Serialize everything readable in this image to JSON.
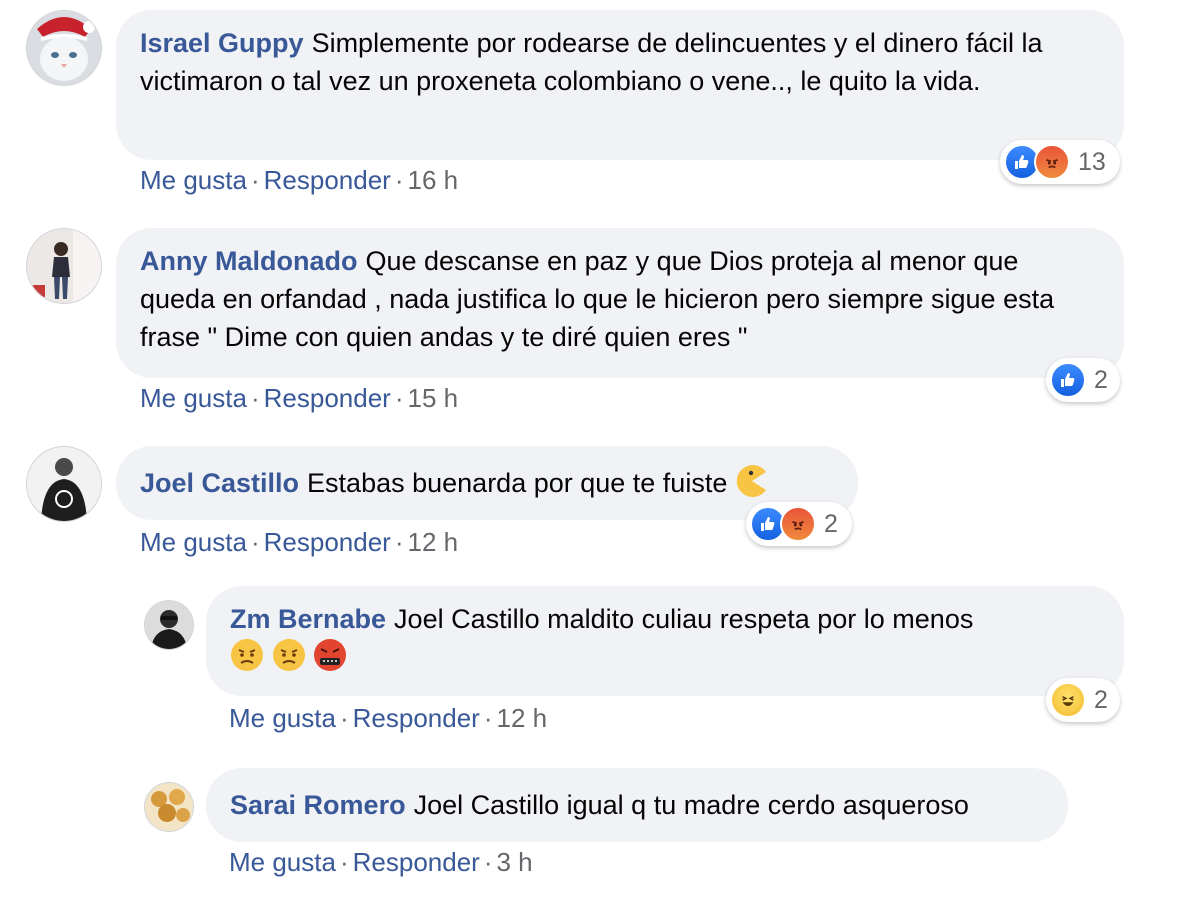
{
  "comments": [
    {
      "author": "Israel Guppy",
      "text": "Simplemente por rodearse de delincuentes y el dinero fácil la victimaron o tal vez un proxeneta colombiano o vene.., le quito la vida.",
      "like_label": "Me gusta",
      "reply_label": "Responder",
      "time": "16 h",
      "reaction_count": "13",
      "reactions": [
        "like-icon",
        "angry-icon"
      ]
    },
    {
      "author": "Anny Maldonado",
      "text": "Que descanse en paz y que Dios proteja al menor que queda en orfandad , nada justifica lo que le hicieron pero siempre sigue esta frase \" Dime con quien andas y te diré quien eres \"",
      "like_label": "Me gusta",
      "reply_label": "Responder",
      "time": "15 h",
      "reaction_count": "2",
      "reactions": [
        "like-icon"
      ]
    },
    {
      "author": "Joel Castillo",
      "text": "Estabas buenarda por que te fuiste",
      "emoji": "pacman-emoji-icon",
      "like_label": "Me gusta",
      "reply_label": "Responder",
      "time": "12 h",
      "reaction_count": "2",
      "reactions": [
        "like-icon",
        "angry-icon"
      ]
    }
  ],
  "replies": [
    {
      "author": "Zm Bernabe",
      "text": "Joel Castillo maldito culiau respeta por lo menos",
      "emojis": [
        "angry-face-icon",
        "angry-face-icon",
        "cursing-face-icon"
      ],
      "like_label": "Me gusta",
      "reply_label": "Responder",
      "time": "12 h",
      "reaction_count": "2",
      "reactions": [
        "haha-icon"
      ]
    },
    {
      "author": "Sarai Romero",
      "text": "Joel Castillo igual q tu madre cerdo asqueroso",
      "like_label": "Me gusta",
      "reply_label": "Responder",
      "time": "3 h"
    }
  ],
  "separator": "·",
  "colors": {
    "link": "#385898",
    "bubble": "#f0f2f5",
    "meta": "#65676b"
  }
}
